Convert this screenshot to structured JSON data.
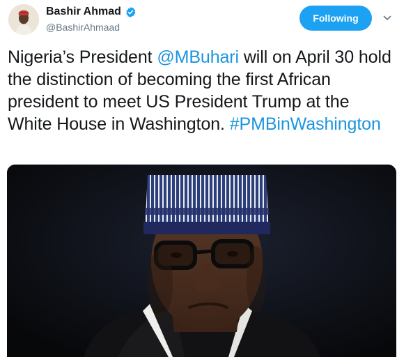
{
  "author": {
    "display_name": "Bashir Ahmad",
    "handle": "@BashirAhmaad",
    "verified": true,
    "verified_icon": "verified-badge-icon"
  },
  "follow_button": {
    "label": "Following"
  },
  "menu_icon": "chevron-down-icon",
  "tweet": {
    "text_before": "Nigeria’s President ",
    "mention": "@MBuhari",
    "text_after": " will on April 30 hold the distinction of becoming the first African president to meet US President Trump at the White House in Washington. ",
    "hashtag": "#PMBinWashington"
  },
  "colors": {
    "link": "#1b95e0",
    "button": "#1da1f2",
    "text": "#14171a",
    "secondary": "#657786"
  }
}
